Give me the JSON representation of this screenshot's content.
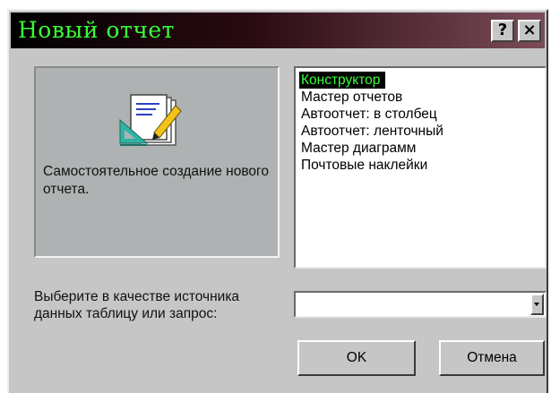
{
  "window": {
    "title": "Новый отчет",
    "help_label": "?",
    "close_label": "×"
  },
  "preview": {
    "icon": "report-design-icon",
    "description": "Самостоятельное создание нового отчета."
  },
  "report_types": {
    "items": [
      "Конструктор",
      "Мастер отчетов",
      "Автоотчет: в столбец",
      "Автоотчет: ленточный",
      "Мастер диаграмм",
      "Почтовые наклейки"
    ],
    "selected": "Конструктор"
  },
  "source": {
    "label": "Выберите в качестве источника данных таблицу или запрос:",
    "value": ""
  },
  "buttons": {
    "ok_label": "OK",
    "cancel_label": "Отмена"
  },
  "colors": {
    "title_text": "#39ff39",
    "selection_bg": "#000000",
    "selection_text": "#39ff39",
    "dialog_bg": "#c6c6c6"
  }
}
